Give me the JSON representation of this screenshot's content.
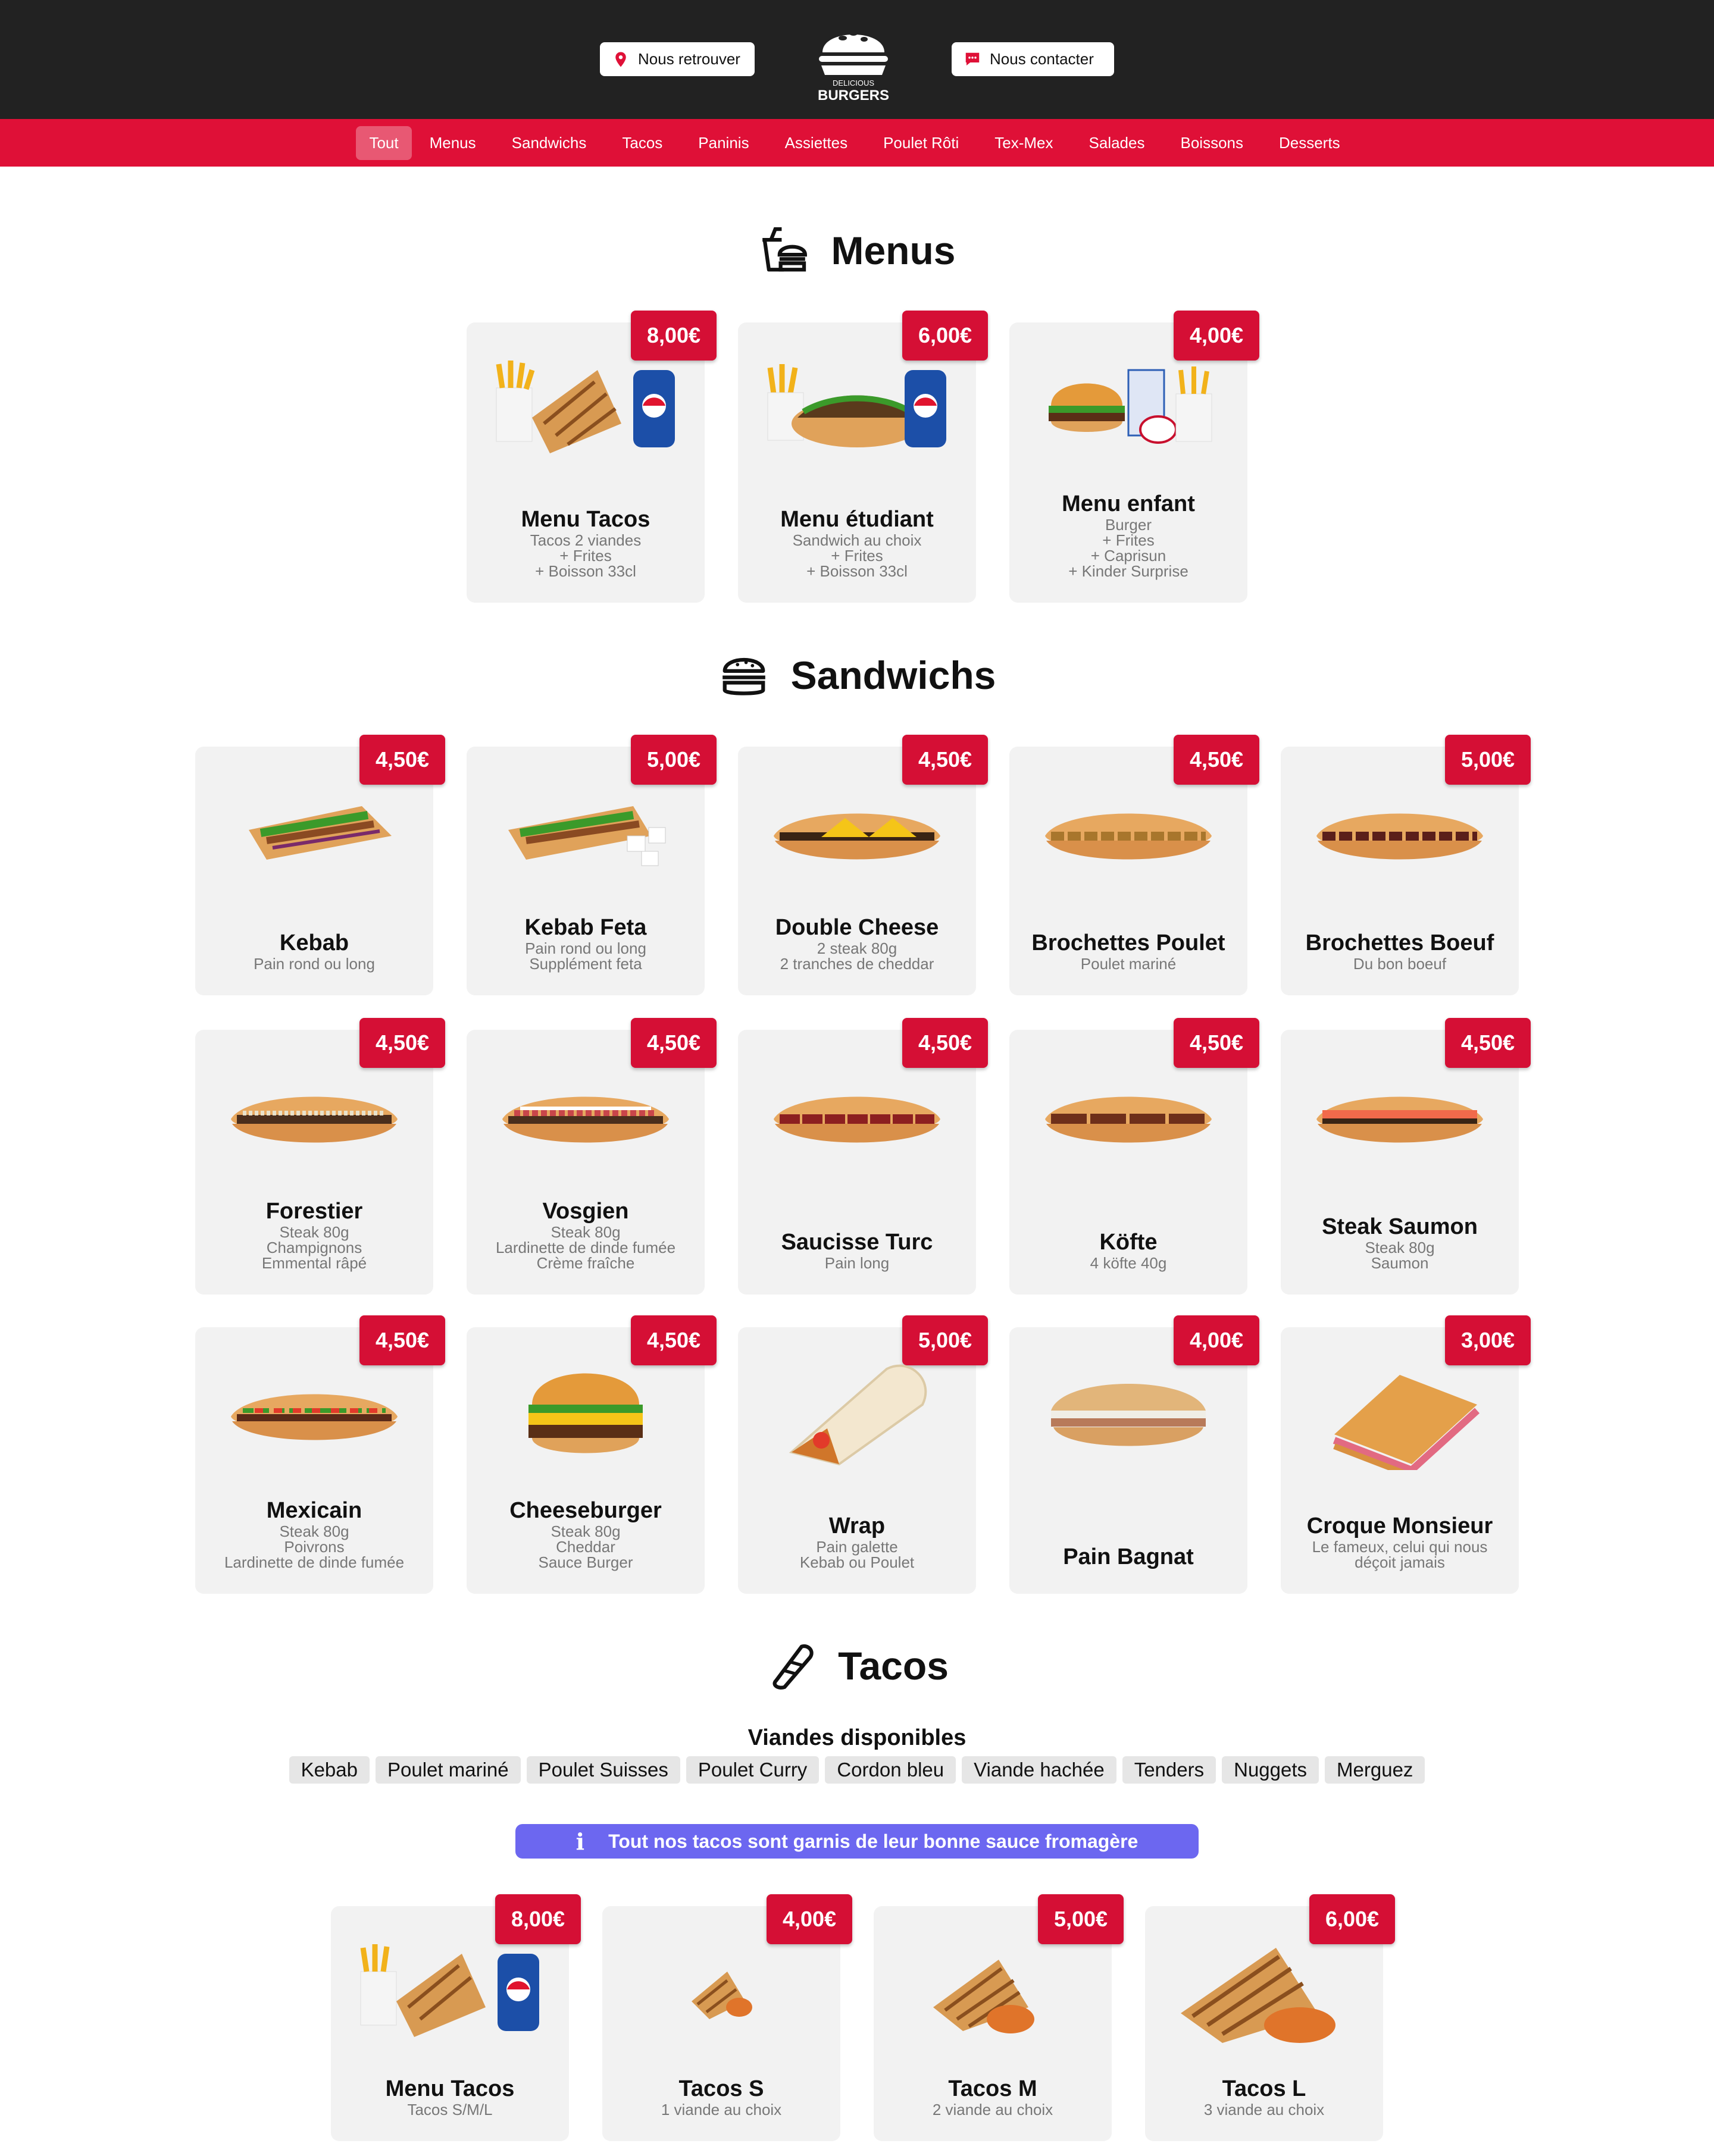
{
  "header": {
    "find_us": "Nous retrouver",
    "contact": "Nous contacter",
    "logo_small": "DELICIOUS",
    "logo_big": "BURGERS"
  },
  "categories": [
    "Tout",
    "Menus",
    "Sandwichs",
    "Tacos",
    "Paninis",
    "Assiettes",
    "Poulet Rôti",
    "Tex-Mex",
    "Salades",
    "Boissons",
    "Desserts"
  ],
  "sections": {
    "menus": "Menus",
    "sandwichs": "Sandwichs",
    "tacos": "Tacos"
  },
  "menus": [
    {
      "name": "Menu Tacos",
      "price": "8,00€",
      "desc": "Tacos 2 viandes\n+ Frites\n+ Boisson 33cl"
    },
    {
      "name": "Menu étudiant",
      "price": "6,00€",
      "desc": "Sandwich au choix\n+ Frites\n+ Boisson 33cl"
    },
    {
      "name": "Menu enfant",
      "price": "4,00€",
      "desc": "Burger\n+ Frites\n+ Caprisun\n+ Kinder Surprise"
    }
  ],
  "sandwichs": [
    {
      "name": "Kebab",
      "price": "4,50€",
      "desc": "Pain rond ou long"
    },
    {
      "name": "Kebab Feta",
      "price": "5,00€",
      "desc": "Pain rond ou long\nSupplément feta"
    },
    {
      "name": "Double Cheese",
      "price": "4,50€",
      "desc": "2 steak 80g\n2 tranches de cheddar"
    },
    {
      "name": "Brochettes Poulet",
      "price": "4,50€",
      "desc": "Poulet mariné"
    },
    {
      "name": "Brochettes Boeuf",
      "price": "5,00€",
      "desc": "Du bon boeuf"
    },
    {
      "name": "Forestier",
      "price": "4,50€",
      "desc": "Steak 80g\nChampignons\nEmmental râpé"
    },
    {
      "name": "Vosgien",
      "price": "4,50€",
      "desc": "Steak 80g\nLardinette de dinde fumée\nCrème fraîche"
    },
    {
      "name": "Saucisse Turc",
      "price": "4,50€",
      "desc": "Pain long"
    },
    {
      "name": "Köfte",
      "price": "4,50€",
      "desc": "4 köfte 40g"
    },
    {
      "name": "Steak Saumon",
      "price": "4,50€",
      "desc": "Steak 80g\nSaumon"
    },
    {
      "name": "Mexicain",
      "price": "4,50€",
      "desc": "Steak 80g\nPoivrons\nLardinette de dinde fumée"
    },
    {
      "name": "Cheeseburger",
      "price": "4,50€",
      "desc": "Steak 80g\nCheddar\nSauce Burger"
    },
    {
      "name": "Wrap",
      "price": "5,00€",
      "desc": "Pain galette\nKebab ou Poulet"
    },
    {
      "name": "Pain Bagnat",
      "price": "4,00€",
      "desc": ""
    },
    {
      "name": "Croque Monsieur",
      "price": "3,00€",
      "desc": "Le fameux, celui qui nous\ndéçoit jamais"
    }
  ],
  "tacos_info": {
    "meats_title": "Viandes disponibles",
    "meats": [
      "Kebab",
      "Poulet mariné",
      "Poulet Suisses",
      "Poulet Curry",
      "Cordon bleu",
      "Viande hachée",
      "Tenders",
      "Nuggets",
      "Merguez"
    ],
    "notice": "Tout nos tacos sont garnis de leur bonne sauce fromagère"
  },
  "tacos": [
    {
      "name": "Menu Tacos",
      "price": "8,00€",
      "desc": "Tacos S/M/L"
    },
    {
      "name": "Tacos S",
      "price": "4,00€",
      "desc": "1 viande au choix"
    },
    {
      "name": "Tacos M",
      "price": "5,00€",
      "desc": "2 viande au choix"
    },
    {
      "name": "Tacos L",
      "price": "6,00€",
      "desc": "3 viande au choix"
    }
  ],
  "colors": {
    "brand_red": "#df1037",
    "price_red": "#d50f35",
    "header_dark": "#222222",
    "card_bg": "#f2f2f2",
    "info_purple": "#6c67f0"
  }
}
